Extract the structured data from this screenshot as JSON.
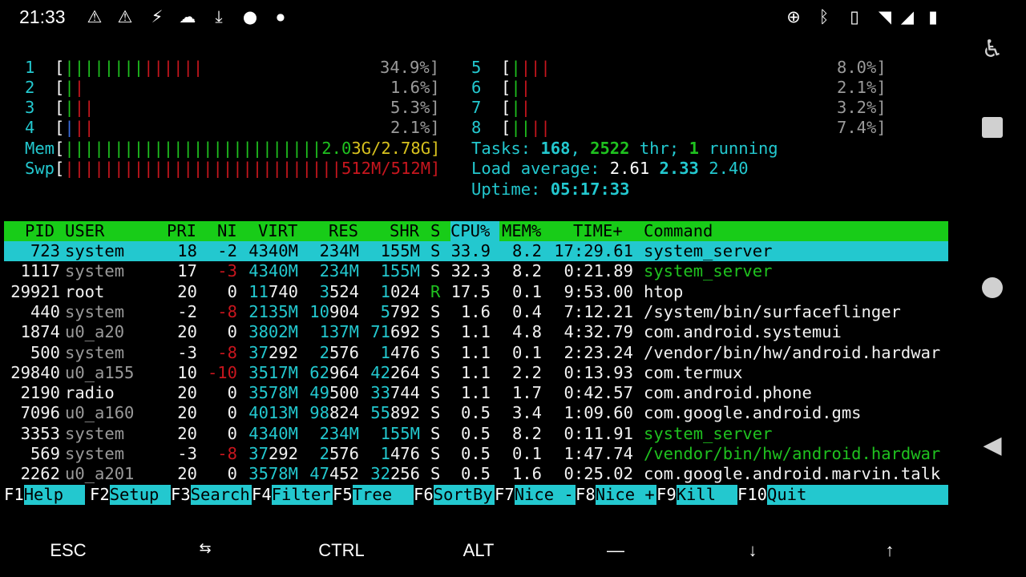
{
  "statusbar": {
    "time": "21:33",
    "icons": [
      "warning-icon",
      "warning-icon",
      "flash-icon",
      "cloud-icon",
      "download-icon",
      "bomb-icon",
      "dot-icon",
      "data-saver-icon",
      "bluetooth-icon",
      "vibrate-icon",
      "wifi-icon",
      "signal-icon",
      "battery-charging-icon"
    ]
  },
  "meters": {
    "cpus": [
      {
        "id": "1",
        "bar_green": "||||||||",
        "bar_red": "||||||",
        "pct": "34.9%]"
      },
      {
        "id": "2",
        "bar_green": "|",
        "bar_red": "|",
        "pct": "1.6%]"
      },
      {
        "id": "3",
        "bar_green": "|",
        "bar_red": "||",
        "pct": "5.3%]"
      },
      {
        "id": "4",
        "bar_blue": "|",
        "bar_red": "||",
        "pct": "2.1%]"
      },
      {
        "id": "5",
        "bar_green": "|",
        "bar_red": "|||",
        "pct": "8.0%]"
      },
      {
        "id": "6",
        "bar_green": "|",
        "bar_red": "|",
        "pct": "2.1%]"
      },
      {
        "id": "7",
        "bar_green": "|",
        "bar_red": "|",
        "pct": "3.2%]"
      },
      {
        "id": "8",
        "bar_green": "||",
        "bar_red": "||",
        "pct": "7.4%]"
      }
    ],
    "mem": {
      "label": "Mem",
      "bar": "||||||||||||||||||||||||||",
      "val1": "2.0",
      "val2": "3G/2.78G]"
    },
    "swp": {
      "label": "Swp",
      "bar": "||||||||||||||||||||||||||||",
      "val": "512M/512M]"
    }
  },
  "summary": {
    "tasks_label": "Tasks: ",
    "tasks": "168",
    "sep": ", ",
    "threads": "2522",
    "thr_label": " thr; ",
    "running": "1",
    "running_label": " running",
    "load_label": "Load average: ",
    "load1": "2.61",
    "load5": "2.33",
    "load15": "2.40",
    "uptime_label": "Uptime: ",
    "uptime": "05:17:33"
  },
  "table": {
    "headers": [
      "PID",
      "USER",
      "PRI",
      "NI",
      "VIRT",
      "RES",
      "SHR",
      "S",
      "CPU%",
      "MEM%",
      "TIME+",
      "Command"
    ],
    "rows": [
      {
        "pid": "723",
        "user": "system",
        "pri": "18",
        "ni": "-2",
        "virt": "4340M",
        "res": "234M",
        "shr": "155M",
        "s": "S",
        "cpu": "33.9",
        "mem": "8.2",
        "time": "17:29.61",
        "cmd": "system_server"
      },
      {
        "pid": "1117",
        "user": "system",
        "pri": "17",
        "ni": "-3",
        "virt": "4340M",
        "res": "234M",
        "shr": "155M",
        "s": "S",
        "cpu": "32.3",
        "mem": "8.2",
        "time": "0:21.89",
        "cmd": "system_server"
      },
      {
        "pid": "29921",
        "user": "root",
        "pri": "20",
        "ni": "0",
        "virt": "11740",
        "res": "3524",
        "shr": "1024",
        "s": "R",
        "cpu": "17.5",
        "mem": "0.1",
        "time": "9:53.00",
        "cmd": "htop"
      },
      {
        "pid": "440",
        "user": "system",
        "pri": "-2",
        "ni": "-8",
        "virt": "2135M",
        "res": "10904",
        "shr": "5792",
        "s": "S",
        "cpu": "1.6",
        "mem": "0.4",
        "time": "7:12.21",
        "cmd": "/system/bin/surfaceflinger"
      },
      {
        "pid": "1874",
        "user": "u0_a20",
        "pri": "20",
        "ni": "0",
        "virt": "3802M",
        "res": "137M",
        "shr": "71692",
        "s": "S",
        "cpu": "1.1",
        "mem": "4.8",
        "time": "4:32.79",
        "cmd": "com.android.systemui"
      },
      {
        "pid": "500",
        "user": "system",
        "pri": "-3",
        "ni": "-8",
        "virt": "37292",
        "res": "2576",
        "shr": "1476",
        "s": "S",
        "cpu": "1.1",
        "mem": "0.1",
        "time": "2:23.24",
        "cmd": "/vendor/bin/hw/android.hardwar"
      },
      {
        "pid": "29840",
        "user": "u0_a155",
        "pri": "10",
        "ni": "-10",
        "virt": "3517M",
        "res": "62964",
        "shr": "42264",
        "s": "S",
        "cpu": "1.1",
        "mem": "2.2",
        "time": "0:13.93",
        "cmd": "com.termux"
      },
      {
        "pid": "2190",
        "user": "radio",
        "pri": "20",
        "ni": "0",
        "virt": "3578M",
        "res": "49500",
        "shr": "33744",
        "s": "S",
        "cpu": "1.1",
        "mem": "1.7",
        "time": "0:42.57",
        "cmd": "com.android.phone"
      },
      {
        "pid": "7096",
        "user": "u0_a160",
        "pri": "20",
        "ni": "0",
        "virt": "4013M",
        "res": "98824",
        "shr": "55892",
        "s": "S",
        "cpu": "0.5",
        "mem": "3.4",
        "time": "1:09.60",
        "cmd": "com.google.android.gms"
      },
      {
        "pid": "3353",
        "user": "system",
        "pri": "20",
        "ni": "0",
        "virt": "4340M",
        "res": "234M",
        "shr": "155M",
        "s": "S",
        "cpu": "0.5",
        "mem": "8.2",
        "time": "0:11.91",
        "cmd": "system_server"
      },
      {
        "pid": "569",
        "user": "system",
        "pri": "-3",
        "ni": "-8",
        "virt": "37292",
        "res": "2576",
        "shr": "1476",
        "s": "S",
        "cpu": "0.5",
        "mem": "0.1",
        "time": "1:47.74",
        "cmd": "/vendor/bin/hw/android.hardwar"
      },
      {
        "pid": "2262",
        "user": "u0_a201",
        "pri": "20",
        "ni": "0",
        "virt": "3578M",
        "res": "47452",
        "shr": "32256",
        "s": "S",
        "cpu": "0.5",
        "mem": "1.6",
        "time": "0:25.02",
        "cmd": "com.google.android.marvin.talk"
      }
    ]
  },
  "fkeys": [
    {
      "num": "F1",
      "label": "Help  "
    },
    {
      "num": "F2",
      "label": "Setup "
    },
    {
      "num": "F3",
      "label": "Search"
    },
    {
      "num": "F4",
      "label": "Filter"
    },
    {
      "num": "F5",
      "label": "Tree  "
    },
    {
      "num": "F6",
      "label": "SortBy"
    },
    {
      "num": "F7",
      "label": "Nice -"
    },
    {
      "num": "F8",
      "label": "Nice +"
    },
    {
      "num": "F9",
      "label": "Kill  "
    },
    {
      "num": "F10",
      "label": "Quit"
    }
  ],
  "extrakeys": [
    "ESC",
    "⇆",
    "CTRL",
    "ALT",
    "—",
    "↓",
    "↑"
  ],
  "nav": [
    "accessibility-icon",
    "overview-icon",
    "home-icon",
    "back-icon"
  ]
}
